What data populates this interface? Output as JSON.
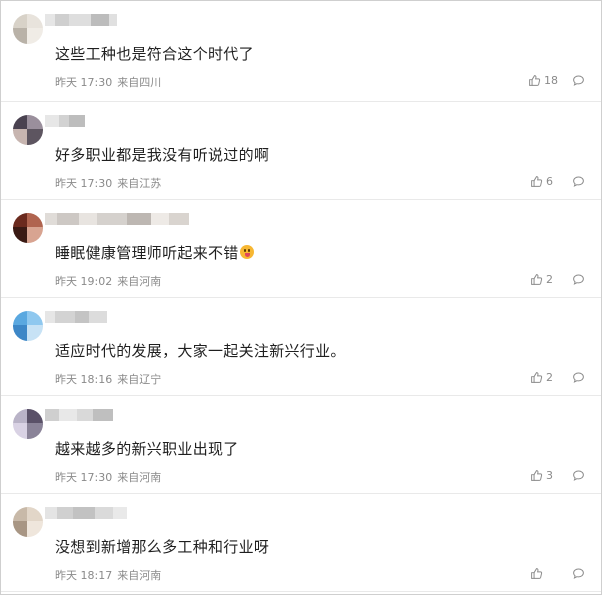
{
  "comments": [
    {
      "text": "这些工种也是符合这个时代了",
      "time": "昨天 17:30",
      "location": "来自四川",
      "likes": "18",
      "has_emoji": false,
      "avatar_colors": [
        "#d8d2c8",
        "#e8e3dc",
        "#b9b2a8",
        "#f0ece6"
      ],
      "username_colors": [
        "#e6e6e6",
        "#cfcfcf",
        "#dedede",
        "#bcbcbc",
        "#e0e0e0"
      ]
    },
    {
      "text": "好多职业都是我没有听说过的啊",
      "time": "昨天 17:30",
      "location": "来自江苏",
      "likes": "6",
      "has_emoji": false,
      "avatar_colors": [
        "#4a4250",
        "#9a8f9c",
        "#c7b5b0",
        "#5d5560"
      ],
      "username_colors": [
        "#e7e7e7",
        "#d2d2d2",
        "#bdbdbd"
      ]
    },
    {
      "text": "睡眠健康管理师听起来不错",
      "time": "昨天 19:02",
      "location": "来自河南",
      "likes": "2",
      "has_emoji": true,
      "avatar_colors": [
        "#6b2a1e",
        "#b0644f",
        "#3a1a14",
        "#d8a491"
      ],
      "username_colors": [
        "#e0dcd8",
        "#cdc8c4",
        "#e8e4e0",
        "#d5d1cd",
        "#bdb7b2",
        "#eeeae6",
        "#d9d4cf"
      ]
    },
    {
      "text": "适应时代的发展，大家一起关注新兴行业。",
      "time": "昨天 18:16",
      "location": "来自辽宁",
      "likes": "2",
      "has_emoji": false,
      "avatar_colors": [
        "#5aa8e0",
        "#8fc8ef",
        "#3d87c7",
        "#c7e2f5"
      ],
      "username_colors": [
        "#e6e6e6",
        "#d3d3d3",
        "#c4c4c4",
        "#dcdcdc"
      ]
    },
    {
      "text": "越来越多的新兴职业出现了",
      "time": "昨天 17:30",
      "location": "来自河南",
      "likes": "3",
      "has_emoji": false,
      "avatar_colors": [
        "#b9b3c7",
        "#5a5168",
        "#d9d2e4",
        "#8a8398"
      ],
      "username_colors": [
        "#cfcfcf",
        "#e8e8e8",
        "#d9d9d9",
        "#bfbfbf"
      ]
    },
    {
      "text": "没想到新增那么多工种和行业呀",
      "time": "昨天 18:17",
      "location": "来自河南",
      "likes": "",
      "has_emoji": false,
      "avatar_colors": [
        "#c8b9a8",
        "#e2d6c8",
        "#a89684",
        "#efe6dc"
      ],
      "username_colors": [
        "#e4e4e4",
        "#d0d0d0",
        "#c2c2c2",
        "#dadada",
        "#e9e9e9"
      ]
    }
  ],
  "icons": {
    "like": "thumbs-up-icon",
    "reply": "comment-bubble-icon",
    "emoji": "tongue-out-emoji-icon"
  }
}
